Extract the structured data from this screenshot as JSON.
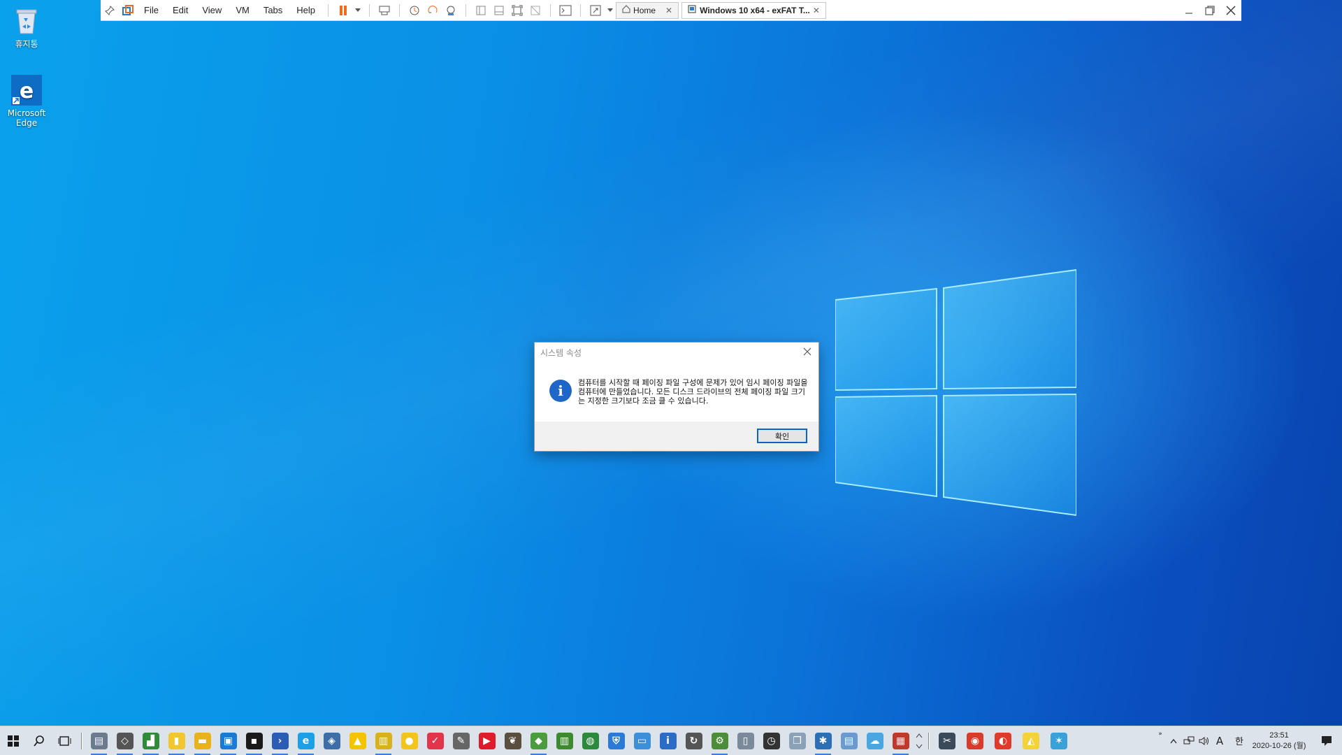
{
  "desktop": {
    "icons": [
      {
        "label": "휴지통",
        "icon": "recycle-bin-icon"
      },
      {
        "label": "Microsoft Edge",
        "icon": "edge-icon"
      }
    ]
  },
  "vmware": {
    "menus": [
      "File",
      "Edit",
      "View",
      "VM",
      "Tabs",
      "Help"
    ],
    "tabs": [
      {
        "label": "Home",
        "active": false
      },
      {
        "label": "Windows 10 x64 - exFAT T...",
        "active": true
      }
    ],
    "pause_color": "#f26a1b"
  },
  "dialog": {
    "title": "시스템 속성",
    "message": "컴퓨터를 시작할 때 페이징 파일 구성에 문제가 있어 임시 페이징 파일을 컴퓨터에 만들었습니다. 모든 디스크 드라이브의 전체 페이징 파일 크기는 지정한 크기보다 조금 클 수 있습니다.",
    "ok_label": "확인",
    "info_glyph": "i"
  },
  "taskbar": {
    "apps": [
      {
        "icon": "picture-viewer-icon",
        "color": "#6b7a8c",
        "glyph": "▤",
        "running": true
      },
      {
        "icon": "diamond-tool-icon",
        "color": "#555555",
        "glyph": "◇",
        "running": true
      },
      {
        "icon": "chart-editor-icon",
        "color": "#2f8a3a",
        "glyph": "▟",
        "running": true
      },
      {
        "icon": "sticky-notes-icon",
        "color": "#f2c62f",
        "glyph": "▮",
        "running": true
      },
      {
        "icon": "file-explorer-icon",
        "color": "#e8b21c",
        "glyph": "▬",
        "running": true
      },
      {
        "icon": "vmware-icon",
        "color": "#1b7ad3",
        "glyph": "▣",
        "running": true
      },
      {
        "icon": "terminal-icon",
        "color": "#1a1a1a",
        "glyph": "▪",
        "running": true
      },
      {
        "icon": "powershell-icon",
        "color": "#2a5bb5",
        "glyph": "›",
        "running": true
      },
      {
        "icon": "internet-explorer-icon",
        "color": "#1ea0e6",
        "glyph": "e",
        "running": true
      },
      {
        "icon": "virtualbox-icon",
        "color": "#3d6ea8",
        "glyph": "◈",
        "running": false
      },
      {
        "icon": "warning-app-icon",
        "color": "#f5c400",
        "glyph": "▲",
        "running": false
      },
      {
        "icon": "folder-tool-icon",
        "color": "#d9b21a",
        "glyph": "▥",
        "running": true
      },
      {
        "icon": "player-icon",
        "color": "#f3c51c",
        "glyph": "●",
        "running": false
      },
      {
        "icon": "pocket-icon",
        "color": "#e2344a",
        "glyph": "✓",
        "running": false
      },
      {
        "icon": "script-editor-icon",
        "color": "#666666",
        "glyph": "✎",
        "running": false
      },
      {
        "icon": "media-player-icon",
        "color": "#e01b2b",
        "glyph": "▶",
        "running": false
      },
      {
        "icon": "gimp-icon",
        "color": "#5a4f3f",
        "glyph": "❦",
        "running": false
      },
      {
        "icon": "layers-icon",
        "color": "#4a9c3c",
        "glyph": "◆",
        "running": true
      },
      {
        "icon": "chart-icon",
        "color": "#3e8a2e",
        "glyph": "▥",
        "running": false
      },
      {
        "icon": "globe-icon",
        "color": "#2c8a3c",
        "glyph": "◍",
        "running": false
      },
      {
        "icon": "shield-icon",
        "color": "#2b7bd6",
        "glyph": "⛨",
        "running": false
      },
      {
        "icon": "monitor-icon",
        "color": "#3c8fd8",
        "glyph": "▭",
        "running": false
      },
      {
        "icon": "info-icon",
        "color": "#2c6cc4",
        "glyph": "i",
        "running": false
      },
      {
        "icon": "refresh-icon",
        "color": "#555555",
        "glyph": "↻",
        "running": false
      },
      {
        "icon": "network-tool-icon",
        "color": "#4c8c3a",
        "glyph": "⚙",
        "running": true
      },
      {
        "icon": "device-icon",
        "color": "#7a8a9a",
        "glyph": "▯",
        "running": false
      },
      {
        "icon": "stopwatch-icon",
        "color": "#333333",
        "glyph": "◷",
        "running": false
      },
      {
        "icon": "puzzle-icon",
        "color": "#8aa1b8",
        "glyph": "❒",
        "running": false
      },
      {
        "icon": "settings-app-icon",
        "color": "#2d6fb5",
        "glyph": "✱",
        "running": true
      },
      {
        "icon": "notepad-icon",
        "color": "#6a9ad0",
        "glyph": "▤",
        "running": false
      },
      {
        "icon": "cloud-icon",
        "color": "#4aa6e0",
        "glyph": "☁",
        "running": false
      },
      {
        "icon": "image-tool-icon",
        "color": "#c0392b",
        "glyph": "▦",
        "running": true
      }
    ],
    "pinned": [
      {
        "icon": "scissors-icon",
        "color": "#3a4a5a",
        "glyph": "✂"
      },
      {
        "icon": "chrome-icon",
        "color": "#d93b2b",
        "glyph": "◉"
      },
      {
        "icon": "color-wheel-icon",
        "color": "#e03a2a",
        "glyph": "◐"
      },
      {
        "icon": "yellow-app-icon",
        "color": "#f3d23a",
        "glyph": "◭"
      },
      {
        "icon": "star-app-icon",
        "color": "#3aa0d8",
        "glyph": "✶"
      }
    ],
    "tray": {
      "ime_language": "A",
      "ime_mode": "한",
      "time": "23:51",
      "date": "2020-10-26 (월)"
    }
  }
}
